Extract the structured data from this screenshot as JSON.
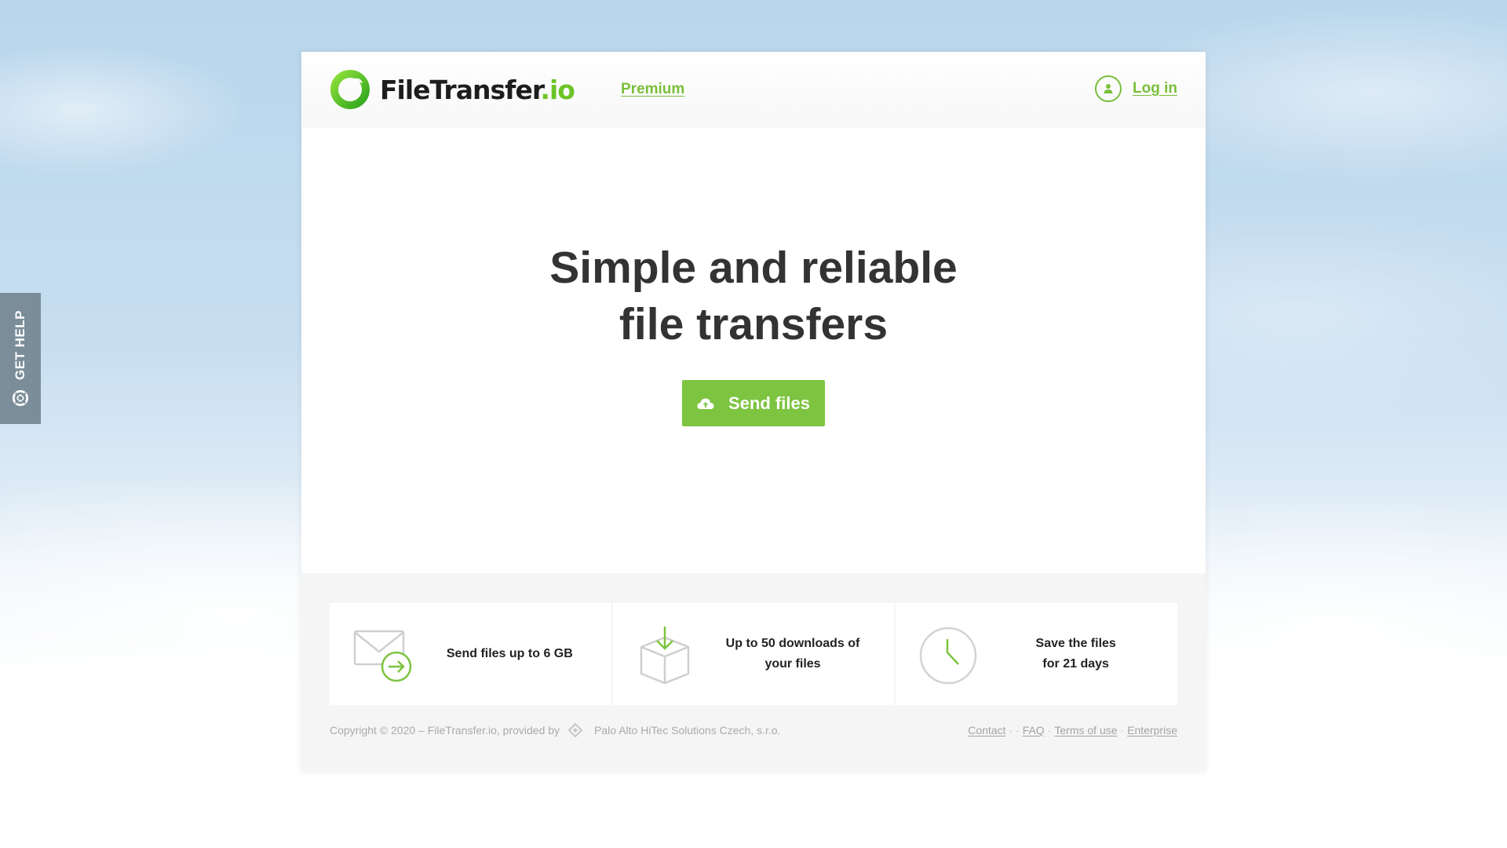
{
  "get_help": {
    "label": "GET HELP",
    "icon": "lifebuoy-icon"
  },
  "header": {
    "logo": {
      "name": "FileTransfer",
      "tld": ".io",
      "icon": "filetransfer-logo-icon"
    },
    "premium_label": "Premium",
    "login_label": "Log in",
    "login_icon": "user-icon"
  },
  "hero": {
    "title_line1": "Simple and reliable",
    "title_line2": "file transfers",
    "send_button_label": "Send files",
    "send_button_icon": "cloud-upload-icon"
  },
  "features": [
    {
      "icon": "envelope-send-icon",
      "line1": "Send files up to 6 GB",
      "line2": ""
    },
    {
      "icon": "box-download-icon",
      "line1": "Up to 50 downloads of",
      "line2": "your files"
    },
    {
      "icon": "clock-icon",
      "line1": "Save the files",
      "line2": "for 21 days"
    }
  ],
  "footer": {
    "copyright": "Copyright © 2020 – FileTransfer.io, provided by",
    "provider_icon": "provider-diamond-icon",
    "provider": "Palo Alto HiTec Solutions Czech, s.r.o.",
    "links": [
      "Contact",
      "FAQ",
      "Terms of use",
      "Enterprise"
    ],
    "separators": [
      "· ·",
      "·",
      "·"
    ]
  },
  "colors": {
    "accent": "#7dc440",
    "link_green": "#79bf3a",
    "logo_green": "#6cc427",
    "help_tab": "#7a8d99",
    "heading": "#333333"
  }
}
